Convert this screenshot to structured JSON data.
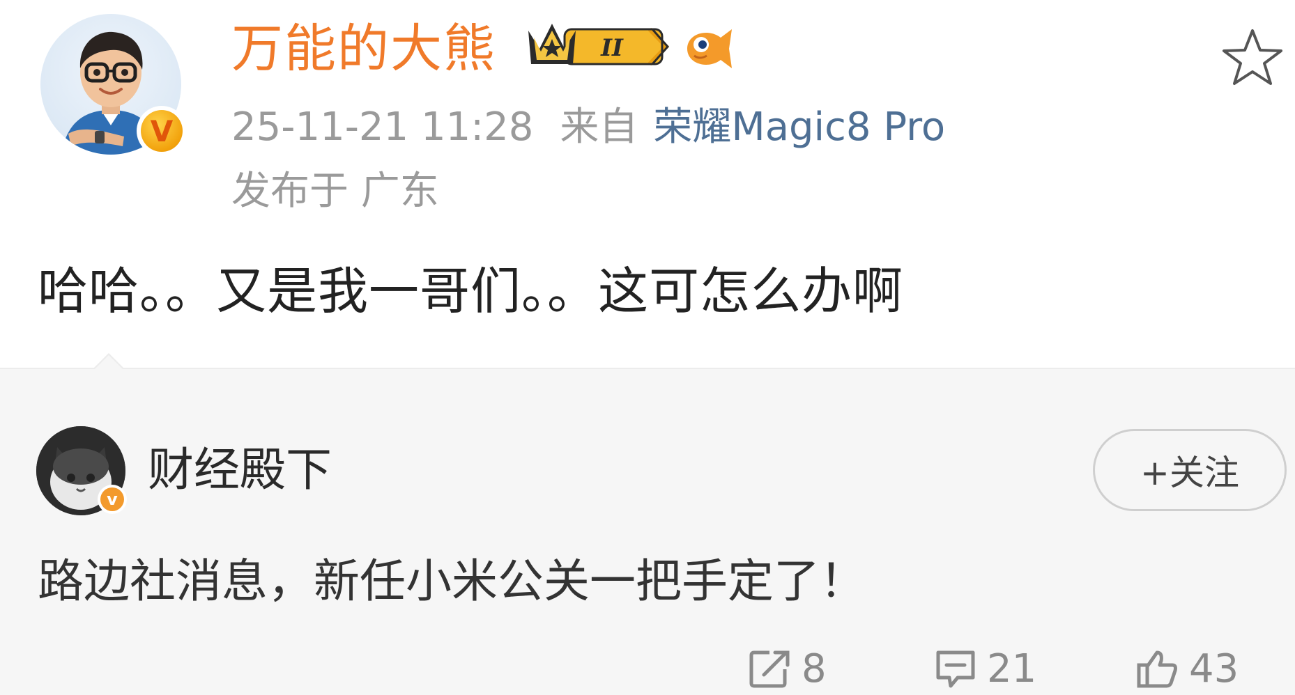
{
  "post": {
    "author": "万能的大熊",
    "level_badge": "II",
    "timestamp": "25-11-21 11:28",
    "source_prefix": "来自",
    "device": "荣耀Magic8 Pro",
    "location": "发布于 广东",
    "text": "哈哈。。又是我一哥们。。这可怎么办啊",
    "verify_mark": "V"
  },
  "repost": {
    "author": "财经殿下",
    "verify_mark": "v",
    "follow_label": "+关注",
    "text": "路边社消息，新任小米公关一把手定了！",
    "actions": {
      "repost_count": "8",
      "comment_count": "21",
      "like_count": "43"
    }
  },
  "colors": {
    "username": "#f07a2a",
    "device_link": "#4e6f94",
    "meta_gray": "#9a9a9a",
    "repost_bg": "#f6f6f6"
  },
  "icons": [
    "star-icon",
    "crown-badge-icon",
    "fish-badge-icon",
    "verified-icon",
    "repost-icon",
    "comment-icon",
    "like-icon"
  ]
}
